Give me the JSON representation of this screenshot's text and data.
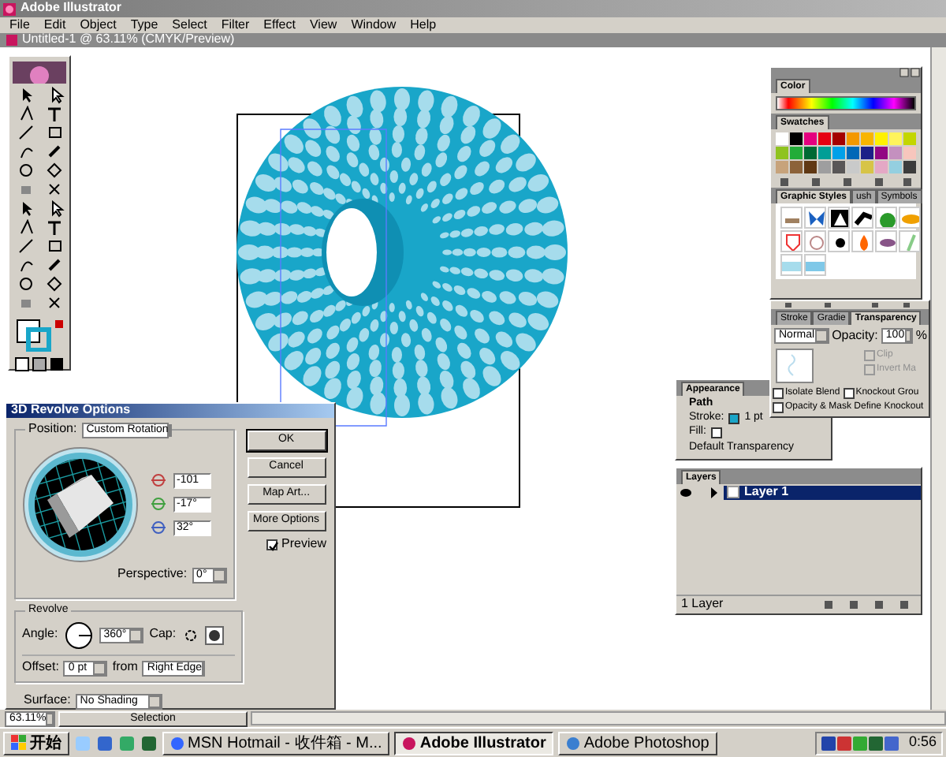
{
  "app": {
    "title": "Adobe Illustrator"
  },
  "menu": [
    "File",
    "Edit",
    "Object",
    "Type",
    "Select",
    "Filter",
    "Effect",
    "View",
    "Window",
    "Help"
  ],
  "document": {
    "title": "Untitled-1 @ 63.11% (CMYK/Preview)"
  },
  "dialog": {
    "title": "3D Revolve Options",
    "position_label": "Position:",
    "position_value": "Custom Rotation",
    "rotations": [
      {
        "value": "-101"
      },
      {
        "value": "-17°"
      },
      {
        "value": "32°"
      }
    ],
    "perspective_label": "Perspective:",
    "perspective_value": "0°",
    "buttons": [
      "OK",
      "Cancel",
      "Map Art...",
      "More Options"
    ],
    "preview": {
      "label": "Preview",
      "checked": true
    },
    "revolve": {
      "title": "Revolve",
      "angle_label": "Angle:",
      "angle_value": "360°",
      "cap_label": "Cap:",
      "offset_label": "Offset:",
      "offset_value": "0 pt",
      "from_label": "from",
      "from_value": "Right Edge"
    },
    "surface_label": "Surface:",
    "surface_value": "No Shading"
  },
  "color_panel": {
    "tab": "Color"
  },
  "swatches_panel": {
    "tab": "Swatches",
    "swatches": [
      {
        "color": "#ffffff"
      },
      {
        "color": "#000000"
      },
      {
        "color": "#e5007f"
      },
      {
        "color": "#e60012"
      },
      {
        "color": "#a40000"
      },
      {
        "color": "#f39800"
      },
      {
        "color": "#f8b500"
      },
      {
        "color": "#fff100"
      },
      {
        "color": "#fff45c"
      },
      {
        "color": "#c3d600"
      },
      {
        "color": "#8fc31f"
      },
      {
        "color": "#22ac38"
      },
      {
        "color": "#006934"
      },
      {
        "color": "#009e96"
      },
      {
        "color": "#00a0e9"
      },
      {
        "color": "#0068b7"
      },
      {
        "color": "#1d2088"
      },
      {
        "color": "#920783"
      },
      {
        "color": "#c490bf"
      },
      {
        "color": "#f7c6bd"
      },
      {
        "color": "#c7a37b"
      },
      {
        "color": "#8c6239"
      },
      {
        "color": "#603813"
      },
      {
        "color": "#9e9e9f"
      },
      {
        "color": "#595757"
      },
      {
        "color": "#c9caca"
      },
      {
        "color": "#d7c447"
      },
      {
        "color": "#e4a8c5"
      },
      {
        "color": "#94cfe0"
      },
      {
        "color": "#3c3c3c"
      }
    ]
  },
  "styles_panel": {
    "tabs": [
      {
        "label": "Graphic Styles",
        "selected": true
      },
      {
        "label": "ush",
        "selected": false
      },
      {
        "label": "Symbols",
        "selected": false
      }
    ]
  },
  "transparency_panel": {
    "tabs": [
      {
        "label": "Stroke",
        "selected": false
      },
      {
        "label": "Gradie",
        "selected": false
      },
      {
        "label": "Transparency",
        "selected": true
      }
    ],
    "blend_mode": "Normal",
    "opacity_label": "Opacity:",
    "opacity_value": "100",
    "opacity_unit": "%",
    "options": [
      {
        "label": "Clip",
        "checked": false,
        "disabled": true
      },
      {
        "label": "Invert Ma",
        "checked": false,
        "disabled": true
      },
      {
        "label": "Isolate Blend",
        "checked": false,
        "disabled": false
      },
      {
        "label": "Knockout Grou",
        "checked": false,
        "disabled": false
      },
      {
        "label": "Opacity & Mask Define Knockout",
        "checked": false,
        "disabled": false
      }
    ]
  },
  "appearance_panel": {
    "tab": "Appearance",
    "target": "Path",
    "rows": [
      {
        "label": "Stroke:",
        "color": "#1aa5c8",
        "value": "1 pt"
      },
      {
        "label": "Fill:",
        "color": "#ffffff"
      }
    ],
    "footer_row": "Default Transparency"
  },
  "layers_panel": {
    "tab": "Layers",
    "layers": [
      {
        "name": "Layer 1",
        "selected": true,
        "visible": true
      }
    ],
    "count": "1 Layer"
  },
  "status_bar": {
    "zoom": "63.11%",
    "tool": "Selection"
  },
  "taskbar": {
    "start": "开始",
    "tasks": [
      {
        "label": "MSN Hotmail - 收件箱 - M...",
        "selected": false
      },
      {
        "label": "Adobe Illustrator",
        "selected": true
      },
      {
        "label": "Adobe Photoshop",
        "selected": false
      }
    ],
    "clock": "0:56"
  }
}
